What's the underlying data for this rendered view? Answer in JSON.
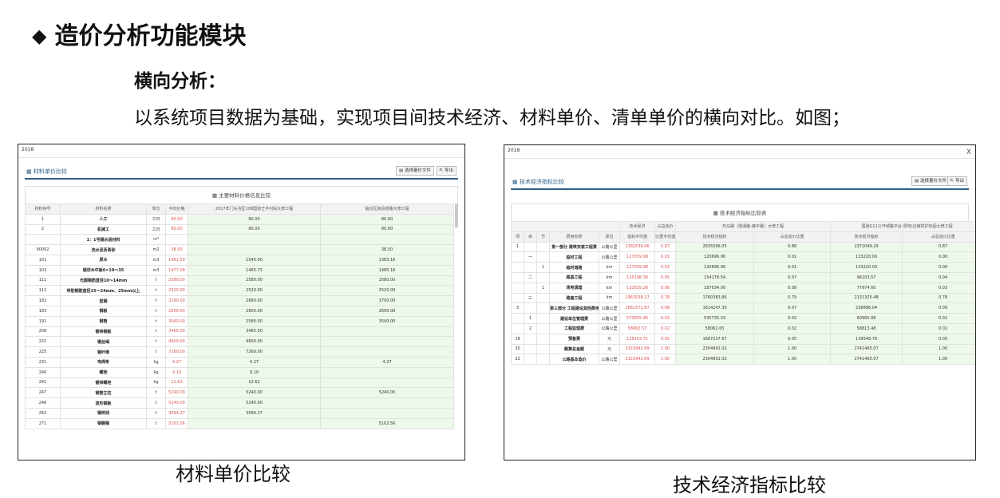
{
  "slide": {
    "title": "造价分析功能模块",
    "subtitle": "横向分析：",
    "description": "以系统项目数据为基础，实现项目间技术经济、材料单价、清单单价的横向对比。如图；",
    "caption_left": "材料单价比较",
    "caption_right": "技术经济指标比较"
  },
  "material": {
    "window_title": "2018",
    "panel_title": "材料单价比较",
    "btn_select": "选择量价文件",
    "btn_export": "导出",
    "table_caption": "主要材料价格信息比较",
    "headers": [
      "材料序号",
      "材料名称",
      "单位",
      "平均价格",
      "2017年门头沟区108国道王平村段大修工程",
      "临汾区房县道路大修工程"
    ],
    "rows": [
      [
        "1",
        "人工",
        "工日",
        "80.00",
        "80.00",
        "80.00"
      ],
      [
        "2",
        "机械工",
        "工日",
        "80.00",
        "80.00",
        "80.00"
      ],
      [
        "",
        "1：1号隔水层材料",
        "m³",
        "",
        "",
        ""
      ],
      [
        "90002",
        "洗水泥沥青砂",
        "m2",
        "38.50",
        "",
        "38.50"
      ],
      [
        "101",
        "原木",
        "m3",
        "1461.50",
        "1540.00",
        "1383.16"
      ],
      [
        "102",
        "锯材木中板δ=19～35",
        "m3",
        "1477.09",
        "1465.73",
        "1485.16"
      ],
      [
        "111",
        "光圆钢筋直径10～14mm",
        "t",
        "2580.00",
        "2580.00",
        "2580.00"
      ],
      [
        "112",
        "带肋钢筋直径15～24mm、25mm以上",
        "t",
        "2520.00",
        "2520.00",
        "2520.00"
      ],
      [
        "182",
        "型钢",
        "t",
        "3190.00",
        "2680.00",
        "3700.00"
      ],
      [
        "183",
        "钢板",
        "t",
        "2600.00",
        "2600.00",
        "2600.00"
      ],
      [
        "191",
        "钢管",
        "t",
        "3040.00",
        "2580.00",
        "3500.00"
      ],
      [
        "208",
        "镀锌钢板",
        "t",
        "3465.00",
        "3465.00",
        ""
      ],
      [
        "221",
        "钢丝绳",
        "t",
        "4600.00",
        "4600.00",
        ""
      ],
      [
        "225",
        "钢纤维",
        "t",
        "7260.00",
        "7260.00",
        ""
      ],
      [
        "231",
        "电焊条",
        "kg",
        "4.27",
        "4.27",
        "4.27"
      ],
      [
        "240",
        "螺栓",
        "kg",
        "9.10",
        "9.10",
        ""
      ],
      [
        "241",
        "镀锌螺栓",
        "kg",
        "12.62",
        "12.62",
        ""
      ],
      [
        "247",
        "钢管立柱",
        "t",
        "5240.00",
        "5240.00",
        "5240.00"
      ],
      [
        "248",
        "波形钢板",
        "t",
        "5240.00",
        "5240.00",
        ""
      ],
      [
        "262",
        "钢绞线",
        "t",
        "3094.27",
        "3094.27",
        ""
      ],
      [
        "271",
        "钢棚钢",
        "t",
        "5102.56",
        "",
        "5102.56"
      ]
    ]
  },
  "tech": {
    "window_title": "2018",
    "close_label": "X",
    "panel_title": "技术经济指标比较",
    "btn_select": "选择量价文件",
    "btn_export": "导出",
    "table_caption": "技术经济指标比较表",
    "group_headers": [
      "技术经济",
      "占总造价",
      "鸡马路（顺通路-薛平路）大修工程",
      "国道G111(开城路平台-周地)边坡防护加固大修工程"
    ],
    "sub_headers": [
      "项",
      "目",
      "节",
      "费用名称",
      "单位",
      "指标平均值",
      "比重平均值",
      "技术经济指标",
      "占总造价比重",
      "技术经济指标",
      "占总造价比重"
    ],
    "rows": [
      [
        "1",
        "",
        "",
        "第一部分 建筑安装工程费",
        "公路公里",
        "2282539.66",
        "0.87",
        "2835596.05",
        "0.88",
        "2372049.26",
        "0.87"
      ],
      [
        "",
        "一",
        "",
        "临时工程",
        "公路公里",
        "127059.98",
        "0.01",
        "120696.96",
        "0.01",
        "133220.00",
        "0.00"
      ],
      [
        "",
        "",
        "1",
        "临时道路",
        "km",
        "127059.98",
        "0.01",
        "120696.96",
        "0.01",
        "133220.00",
        "0.00"
      ],
      [
        "",
        "二",
        "",
        "路基工程",
        "km",
        "125198.36",
        "0.05",
        "154178.54",
        "0.07",
        "96103.57",
        "0.04"
      ],
      [
        "",
        "",
        "1",
        "场地清理",
        "km",
        "132835.26",
        "0.06",
        "187034.00",
        "0.08",
        "77974.60",
        "0.03"
      ],
      [
        "",
        "三",
        "",
        "路面工程",
        "km",
        "1963538.17",
        "0.78",
        "1760383.86",
        "0.79",
        "2131325.48",
        "0.78"
      ],
      [
        "3",
        "",
        "",
        "第三部分 工程建设其他费用",
        "公路公里",
        "2661571.67",
        "0.08",
        "1614247.30",
        "0.07",
        "238896.04",
        "0.09"
      ],
      [
        "",
        "1",
        "",
        "建设单位管理费",
        "公路公里",
        "570655.96",
        "0.02",
        "535735.03",
        "0.02",
        "60965.88",
        "0.02"
      ],
      [
        "",
        "2",
        "",
        "工程监理费",
        "公路公里",
        "58663.57",
        "0.02",
        "58062.65",
        "0.02",
        "58813.48",
        "0.02"
      ],
      [
        "18",
        "",
        "",
        "预备费",
        "元",
        "128153.71",
        "0.05",
        "1687237.67",
        "0.05",
        "139549.76",
        "0.05"
      ],
      [
        "20",
        "",
        "",
        "概算总金额",
        "元",
        "2322942.69",
        "1.00",
        "2304991.02",
        "1.00",
        "2741465.07",
        "1.00"
      ],
      [
        "22",
        "",
        "",
        "公路基本造价",
        "公路公里",
        "2322942.69",
        "1.00",
        "2304991.02",
        "1.00",
        "2741465.07",
        "1.00"
      ]
    ]
  }
}
